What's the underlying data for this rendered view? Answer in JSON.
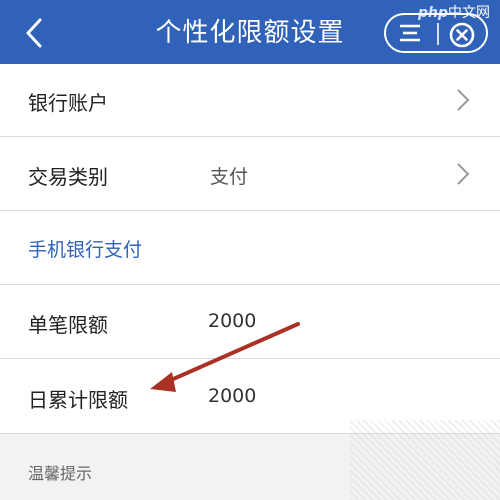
{
  "header": {
    "title": "个性化限额设置",
    "back_icon": "chevron-left-icon",
    "menu_icon": "menu-icon",
    "close_icon": "close-circle-icon",
    "bg_color": "#2f62b8"
  },
  "watermark": {
    "brand": "php",
    "text": "中文网"
  },
  "rows": {
    "bank_account": {
      "label": "银行账户",
      "value": ""
    },
    "transaction_type": {
      "label": "交易类别",
      "value": "支付"
    },
    "section": {
      "label": "手机银行支付"
    },
    "single_limit": {
      "label": "单笔限额",
      "value": "2000"
    },
    "daily_limit": {
      "label": "日累计限额",
      "value": "2000"
    }
  },
  "footer": {
    "tip": "温馨提示"
  },
  "annotation": {
    "arrow_color": "#a93224"
  }
}
